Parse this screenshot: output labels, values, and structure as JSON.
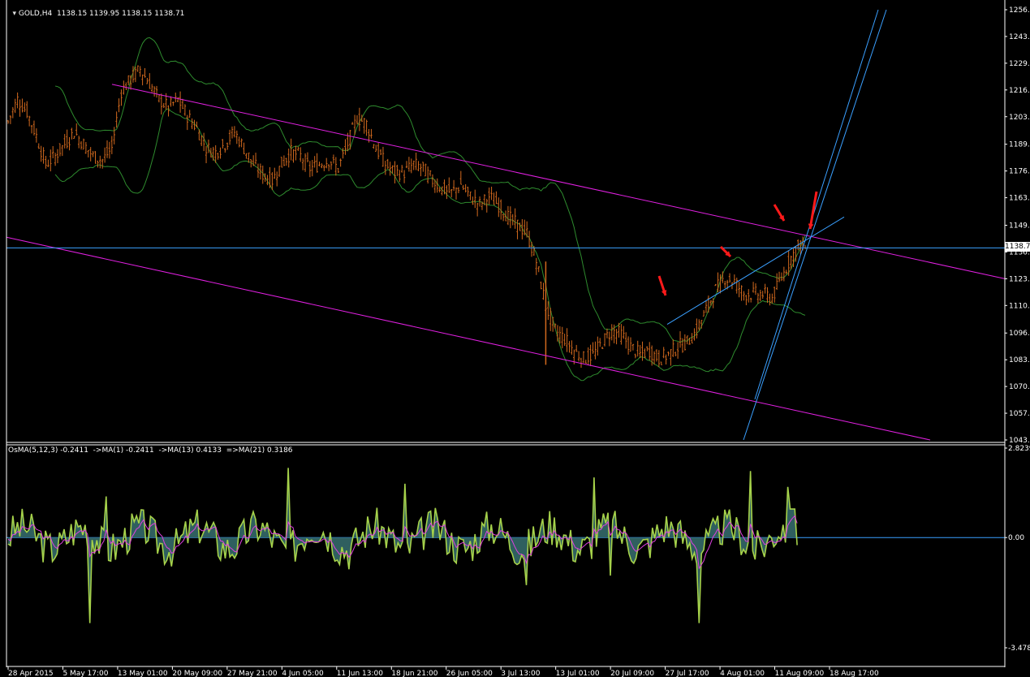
{
  "main_header": {
    "label": "GOLD,H4",
    "ohlc": "1138.15 1139.95 1138.15 1138.71"
  },
  "osc_header": {
    "label": "OsMA(5,12,3) -0.2411  ->MA(1) -0.2411  ->MA(13) 0.4133  =>MA(21) 0.3186"
  },
  "current_price_label": "1138.7",
  "colors": {
    "background": "#000000",
    "bars": "#d2691e",
    "bollinger": "#2e8b2e",
    "channel": "#e020e0",
    "trendline": "#3aa0ff",
    "osc_fill": "#2f5f5f",
    "osc_line": "#a6d24a",
    "osc_signal": "#e040e0",
    "arrows": "#ff1a1a",
    "axis_text": "#ffffff"
  },
  "chart_data": [
    {
      "type": "candlestick",
      "title": "GOLD,H4",
      "y_ticks": [
        "1256.3",
        "1243.1",
        "1229.9",
        "1216.7",
        "1203.5",
        "1189.9",
        "1176.7",
        "1163.5",
        "1149.9",
        "1136.7",
        "1123.5",
        "1110.3",
        "1096.7",
        "1083.5",
        "1070.3",
        "1057.1",
        "1043.9"
      ],
      "ylim": [
        1043.9,
        1256.3
      ],
      "x_ticks": [
        "28 Apr 2015",
        "5 May 17:00",
        "13 May 01:00",
        "20 May 09:00",
        "27 May 21:00",
        "4 Jun 05:00",
        "11 Jun 13:00",
        "18 Jun 21:00",
        "26 Jun 05:00",
        "3 Jul 13:00",
        "13 Jul 01:00",
        "20 Jul 09:00",
        "27 Jul 17:00",
        "4 Aug 01:00",
        "11 Aug 09:00",
        "18 Aug 17:00"
      ],
      "last_price": 1138.71,
      "close_path": [
        [
          0,
          1201
        ],
        [
          4,
          1212
        ],
        [
          8,
          1206
        ],
        [
          12,
          1194
        ],
        [
          16,
          1180
        ],
        [
          20,
          1184
        ],
        [
          24,
          1190
        ],
        [
          28,
          1196
        ],
        [
          32,
          1190
        ],
        [
          36,
          1184
        ],
        [
          40,
          1182
        ],
        [
          44,
          1188
        ],
        [
          48,
          1216
        ],
        [
          52,
          1222
        ],
        [
          56,
          1227
        ],
        [
          60,
          1220
        ],
        [
          64,
          1212
        ],
        [
          68,
          1208
        ],
        [
          72,
          1212
        ],
        [
          76,
          1204
        ],
        [
          80,
          1198
        ],
        [
          84,
          1188
        ],
        [
          88,
          1186
        ],
        [
          92,
          1190
        ],
        [
          96,
          1196
        ],
        [
          100,
          1188
        ],
        [
          104,
          1180
        ],
        [
          108,
          1175
        ],
        [
          112,
          1172
        ],
        [
          116,
          1180
        ],
        [
          120,
          1186
        ],
        [
          124,
          1184
        ],
        [
          128,
          1178
        ],
        [
          132,
          1180
        ],
        [
          136,
          1182
        ],
        [
          140,
          1178
        ],
        [
          144,
          1190
        ],
        [
          148,
          1203
        ],
        [
          152,
          1200
        ],
        [
          156,
          1188
        ],
        [
          160,
          1180
        ],
        [
          164,
          1176
        ],
        [
          168,
          1176
        ],
        [
          172,
          1180
        ],
        [
          176,
          1178
        ],
        [
          180,
          1172
        ],
        [
          184,
          1168
        ],
        [
          188,
          1166
        ],
        [
          192,
          1170
        ],
        [
          196,
          1164
        ],
        [
          200,
          1160
        ],
        [
          204,
          1164
        ],
        [
          208,
          1160
        ],
        [
          212,
          1154
        ],
        [
          216,
          1150
        ],
        [
          220,
          1146
        ],
        [
          224,
          1132
        ],
        [
          228,
          1110
        ],
        [
          232,
          1098
        ],
        [
          236,
          1094
        ],
        [
          240,
          1088
        ],
        [
          244,
          1084
        ],
        [
          248,
          1086
        ],
        [
          252,
          1092
        ],
        [
          256,
          1098
        ],
        [
          260,
          1096
        ],
        [
          264,
          1090
        ],
        [
          268,
          1086
        ],
        [
          272,
          1088
        ],
        [
          276,
          1084
        ],
        [
          280,
          1086
        ],
        [
          284,
          1090
        ],
        [
          288,
          1092
        ],
        [
          292,
          1098
        ],
        [
          296,
          1108
        ],
        [
          300,
          1118
        ],
        [
          304,
          1124
        ],
        [
          308,
          1122
        ],
        [
          312,
          1116
        ],
        [
          316,
          1116
        ],
        [
          320,
          1116
        ],
        [
          324,
          1114
        ],
        [
          328,
          1124
        ],
        [
          332,
          1134
        ],
        [
          336,
          1141
        ],
        [
          338,
          1139
        ]
      ],
      "channel_upper": {
        "from": [
          138,
          1219.5
        ],
        "to": [
          1238,
          1123.5
        ]
      },
      "channel_lower": {
        "from": [
          8,
          1144
        ],
        "to": [
          1146,
          1043.9
        ]
      },
      "trendline_short": {
        "from": [
          822,
          1101
        ],
        "to": [
          1040,
          1154
        ]
      },
      "steep_line_a": {
        "from": [
          916,
          1043.9
        ],
        "to": [
          1092,
          1256.3
        ]
      },
      "steep_line_b": {
        "from": [
          930,
          1064
        ],
        "to": [
          1082,
          1256.3
        ]
      },
      "horizontal_line": 1138.71,
      "red_arrows": [
        "near 16 Jul low",
        "near 10 Aug",
        "channel touch",
        "breakout candle"
      ]
    },
    {
      "type": "line",
      "title": "OsMA(5,12,3)",
      "y_ticks": [
        "2.8239",
        "0.00",
        "-3.4784"
      ],
      "ylim": [
        -3.4784,
        2.8239
      ],
      "zero_line": 0.0,
      "series": [
        {
          "name": "OsMA(5,12,3)",
          "value": -0.2411
        },
        {
          "name": "MA(13)",
          "value": 0.4133
        },
        {
          "name": "MA(21)",
          "value": 0.3186
        }
      ]
    }
  ]
}
